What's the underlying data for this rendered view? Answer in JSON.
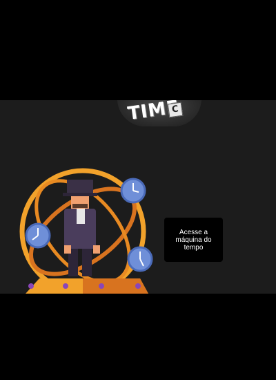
{
  "logo": {
    "text": "TIME",
    "badge_letter": "C"
  },
  "cta": {
    "label": "Acesse a máquina do tempo"
  },
  "colors": {
    "page_background": "#000000",
    "panel_background": "#1c1c1c",
    "ring_orange": "#f2a22b",
    "ring_dark_orange": "#d8731f",
    "clock_blue": "#6f8fd8",
    "suit_purple": "#4a3d5c",
    "base_purple_dots": "#8a46b8"
  },
  "icons": [
    "time-machine-illustration",
    "clock-icon",
    "top-hat-man-figure"
  ]
}
